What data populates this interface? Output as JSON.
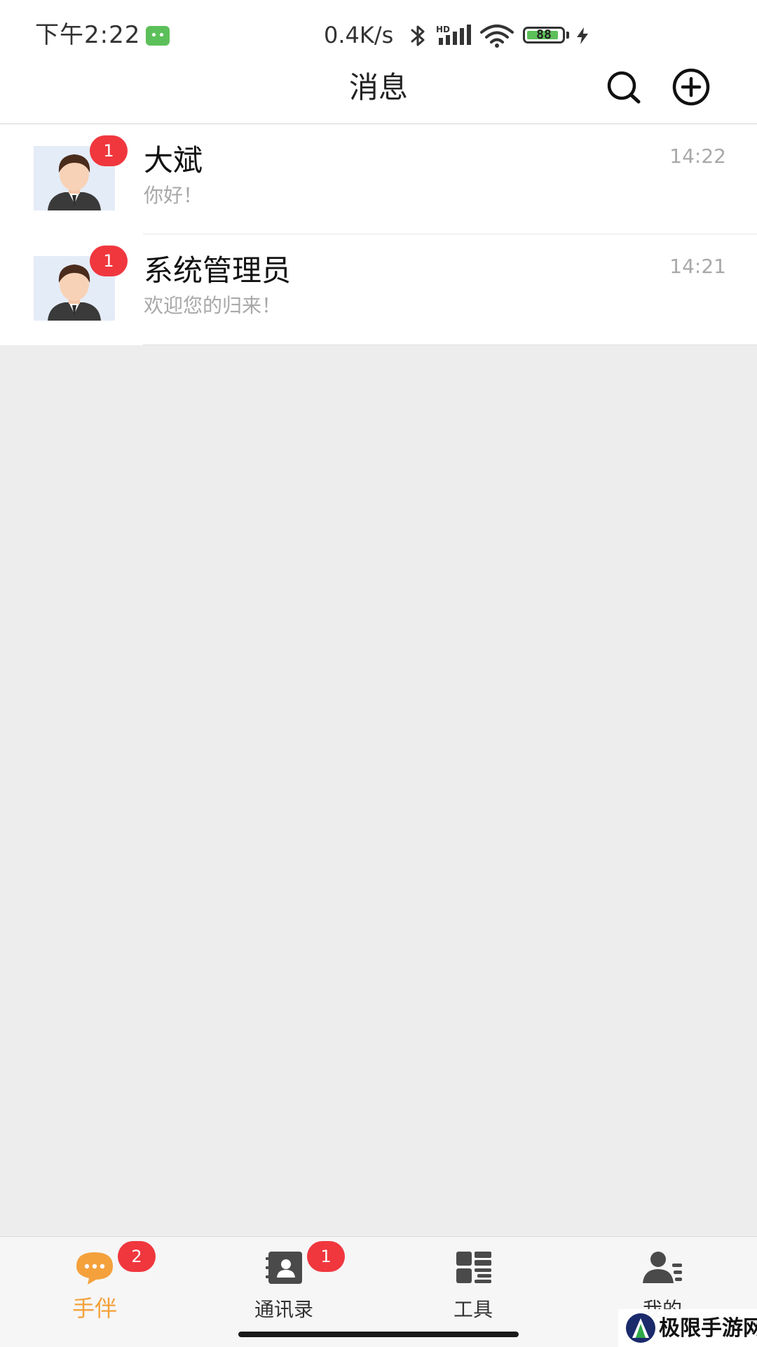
{
  "status_bar": {
    "time": "下午2:22",
    "network_speed": "0.4K/s",
    "signal_label": "HD",
    "battery": "88"
  },
  "navbar": {
    "title": "消息"
  },
  "conversations": [
    {
      "name": "大斌",
      "preview": "你好！",
      "time": "14:22",
      "unread": "1"
    },
    {
      "name": "系统管理员",
      "preview": "欢迎您的归来！",
      "time": "14:21",
      "unread": "1"
    }
  ],
  "tabs": [
    {
      "label": "手伴",
      "badge": "2",
      "icon": "chat-bubble-icon",
      "active": true
    },
    {
      "label": "通讯录",
      "badge": "1",
      "icon": "contacts-book-icon",
      "active": false
    },
    {
      "label": "工具",
      "badge": "",
      "icon": "grid-tools-icon",
      "active": false
    },
    {
      "label": "我的",
      "badge": "",
      "icon": "user-profile-icon",
      "active": false
    }
  ],
  "watermark": {
    "text": "极限手游网"
  },
  "colors": {
    "accent": "#f4a13c",
    "badge": "#f0373e",
    "background": "#ededed",
    "text_muted": "#a8a8a8"
  }
}
